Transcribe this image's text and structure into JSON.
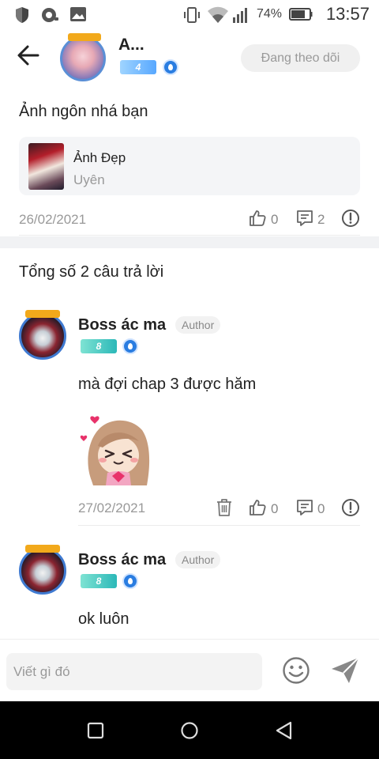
{
  "status_bar": {
    "battery_percent": "74%",
    "time": "13:57",
    "icons": [
      "shield-icon",
      "headset-icon",
      "image-icon",
      "vibrate-icon",
      "wifi-icon",
      "signal-icon",
      "battery-icon"
    ]
  },
  "header": {
    "user_name": "A...",
    "user_level": "4",
    "follow_label": "Đang theo dõi"
  },
  "post": {
    "title": "Ảnh ngôn nhá bạn",
    "book": {
      "name": "Ảnh Đẹp",
      "author": "Uyên"
    },
    "date": "26/02/2021",
    "likes": "0",
    "comments": "2"
  },
  "replies_heading": "Tổng số 2 câu trả lời",
  "replies": [
    {
      "name": "Boss ác ma",
      "tag": "Author",
      "level": "8",
      "text": "mà đợi chap 3 được hăm",
      "has_sticker": true,
      "date": "27/02/2021",
      "likes": "0",
      "comments": "0"
    },
    {
      "name": "Boss ác ma",
      "tag": "Author",
      "level": "8",
      "text": "ok luôn"
    }
  ],
  "composer": {
    "placeholder": "Viết gì đó"
  },
  "colors": {
    "accent_blue": "#2a7de1",
    "level_teal": "#2bb8b8",
    "muted_text": "#999999"
  }
}
